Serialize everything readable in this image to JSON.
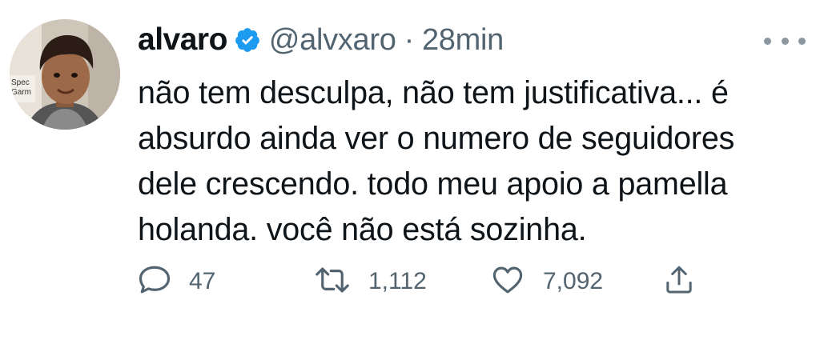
{
  "tweet": {
    "display_name": "alvaro",
    "handle": "@alvxaro",
    "separator": "·",
    "time": "28min",
    "text_lines": [
      "não tem desculpa, não tem justificativa... é",
      "absurdo ainda ver o numero de seguidores",
      "dele crescendo. todo meu apoio a pamella",
      "holanda. você não está sozinha."
    ],
    "avatar_text": [
      "Spec",
      "Garm"
    ],
    "verified_icon": "verified-badge-icon",
    "colors": {
      "verified": "#1d9bf0",
      "secondary_text": "#536471",
      "primary_text": "#0f1419"
    }
  },
  "actions": {
    "replies": "47",
    "retweets": "1,112",
    "likes": "7,092"
  },
  "icons": {
    "reply": "speech-bubble-icon",
    "retweet": "retweet-arrows-icon",
    "like": "heart-icon",
    "share": "share-upload-icon",
    "more": "more-dots-icon"
  }
}
